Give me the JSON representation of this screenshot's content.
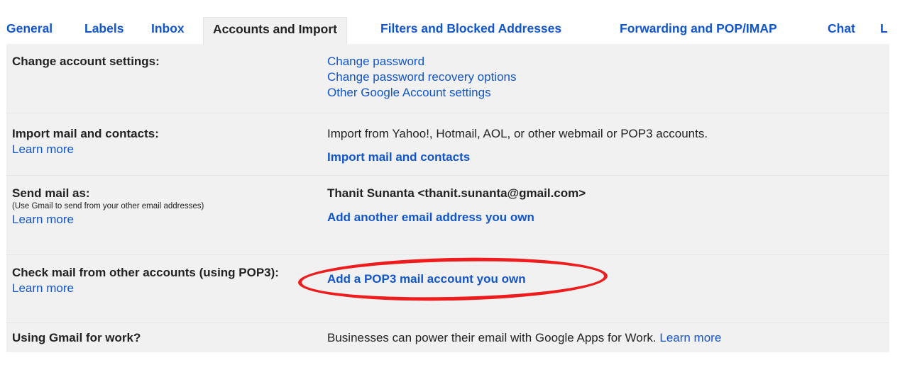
{
  "tabs": [
    {
      "label": "General"
    },
    {
      "label": "Labels"
    },
    {
      "label": "Inbox"
    },
    {
      "label": "Accounts and Import",
      "active": true
    },
    {
      "label": "Filters and Blocked Addresses"
    },
    {
      "label": "Forwarding and POP/IMAP"
    },
    {
      "label": "Chat"
    },
    {
      "label": "L"
    }
  ],
  "rows": {
    "change_account": {
      "label": "Change account settings:",
      "links": [
        "Change password",
        "Change password recovery options",
        "Other Google Account settings"
      ]
    },
    "import": {
      "label": "Import mail and contacts:",
      "learn_more": "Learn more",
      "description": "Import from Yahoo!, Hotmail, AOL, or other webmail or POP3 accounts.",
      "action": "Import mail and contacts"
    },
    "send_as": {
      "label": "Send mail as:",
      "hint": "(Use Gmail to send from your other email addresses)",
      "learn_more": "Learn more",
      "address": "Thanit Sunanta <thanit.sunanta@gmail.com>",
      "action": "Add another email address you own"
    },
    "check_mail": {
      "label": "Check mail from other accounts (using POP3):",
      "learn_more": "Learn more",
      "action": "Add a POP3 mail account you own"
    },
    "work": {
      "label": "Using Gmail for work?",
      "description": "Businesses can power their email with Google Apps for Work.",
      "learn_more": "Learn more"
    }
  },
  "colors": {
    "link": "#1155cc",
    "panel_bg": "#f1f1f1",
    "highlight_oval": "#ee1c1c"
  }
}
